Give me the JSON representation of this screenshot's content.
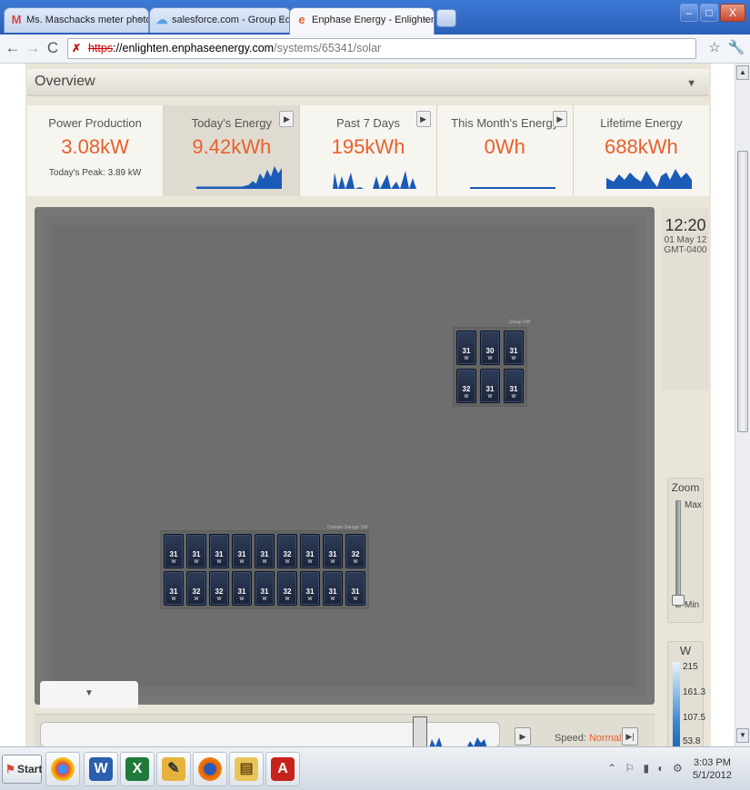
{
  "browser": {
    "tabs": [
      {
        "title": "Ms. Maschacks meter photos - ",
        "icon": "gmail-icon",
        "close": "×"
      },
      {
        "title": "salesforce.com - Group Edition",
        "icon": "salesforce-icon",
        "close": "×"
      },
      {
        "title": "Enphase Energy - Enlighten | ",
        "icon": "enphase-icon",
        "close": "×"
      }
    ],
    "window_controls": {
      "minimize": "–",
      "maximize": "□",
      "close": "X"
    },
    "url": {
      "protocol": "https",
      "host": "://enlighten.enphaseenergy.com",
      "path": "/systems/65341/solar"
    }
  },
  "page": {
    "section_title": "Overview",
    "stats": [
      {
        "label": "Power Production",
        "value": "3.08kW",
        "sub": "Today's Peak: 3.89 kW"
      },
      {
        "label": "Today's Energy",
        "value": "9.42kWh",
        "sub": ""
      },
      {
        "label": "Past 7 Days",
        "value": "195kWh",
        "sub": ""
      },
      {
        "label": "This Month's Energy",
        "value": "0Wh",
        "sub": ""
      },
      {
        "label": "Lifetime Energy",
        "value": "688kWh",
        "sub": ""
      }
    ],
    "clock": {
      "time": "12:20",
      "date": "01 May 12",
      "timezone": "GMT-0400"
    },
    "zoom": {
      "title": "Zoom",
      "max": "Max",
      "min": "Min",
      "level": 0
    },
    "legend": {
      "title": "W",
      "ticks": [
        "215",
        "161.3",
        "107.5",
        "53.8"
      ]
    },
    "arrays": [
      {
        "label": "Group SW",
        "rows": [
          [
            "31",
            "30",
            "31"
          ],
          [
            "32",
            "31",
            "31"
          ]
        ],
        "unit": "W"
      },
      {
        "label": "Outside Garage SW",
        "rows": [
          [
            "31",
            "31",
            "31",
            "31",
            "31",
            "32",
            "31",
            "31",
            "32"
          ],
          [
            "31",
            "32",
            "32",
            "31",
            "31",
            "32",
            "31",
            "31",
            "31"
          ]
        ],
        "unit": "W"
      }
    ],
    "drawer_icon": "▼",
    "timeline": {
      "speed_label": "Speed:",
      "speed_value": "Normal"
    }
  },
  "taskbar": {
    "start_label": "Start",
    "apps": [
      "chrome-icon",
      "word-icon",
      "excel-icon",
      "notes-icon",
      "firefox-icon",
      "explorer-icon",
      "acrobat-icon"
    ],
    "clock_time": "3:03 PM",
    "clock_date": "5/1/2012"
  },
  "colors": {
    "accent": "#e8602c",
    "panel": "#1f2a40",
    "map_bg": "#6e6e6e"
  }
}
